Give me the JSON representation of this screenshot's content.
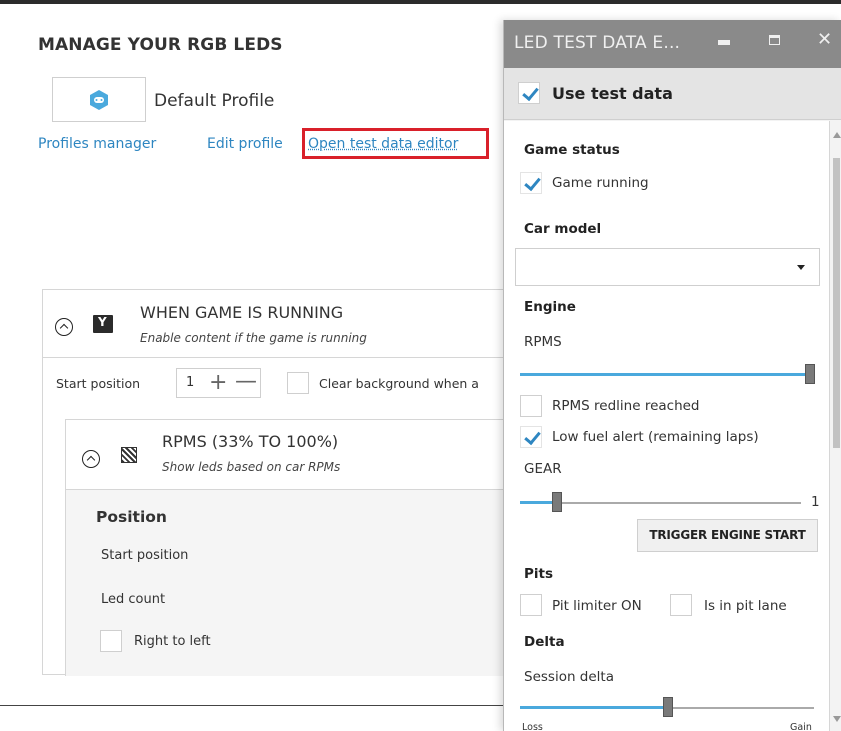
{
  "main": {
    "title": "MANAGE YOUR RGB LEDS",
    "profile_name": "Default Profile",
    "links": {
      "profiles_manager": "Profiles manager",
      "edit_profile": "Edit profile",
      "open_test_data_editor": "Open test data editor"
    },
    "section": {
      "title": "WHEN GAME IS RUNNING",
      "subtitle": "Enable content if the game is running",
      "start_position_label": "Start position",
      "start_position_value": "1",
      "clear_background_label": "Clear background when a"
    },
    "rpms": {
      "title": "RPMS (33% TO 100%)",
      "subtitle": "Show leds based on car RPMs",
      "position_heading": "Position",
      "start_position_label": "Start position",
      "led_count_label": "Led count",
      "right_to_left_label": "Right to left"
    }
  },
  "test_window": {
    "title": "LED TEST DATA E...",
    "use_test_data": {
      "label": "Use test data",
      "checked": true
    },
    "game_status": {
      "heading": "Game status",
      "game_running": {
        "label": "Game running",
        "checked": true
      }
    },
    "car_model": {
      "heading": "Car model",
      "value": ""
    },
    "engine": {
      "heading": "Engine",
      "rpms_label": "RPMS",
      "rpms_level": 1.0,
      "redline": {
        "label": "RPMS redline reached",
        "checked": false
      },
      "low_fuel": {
        "label": "Low fuel alert (remaining laps)",
        "checked": true
      },
      "gear_label": "GEAR",
      "gear_value": "1",
      "trigger_label": "TRIGGER ENGINE START"
    },
    "pits": {
      "heading": "Pits",
      "limiter": {
        "label": "Pit limiter ON",
        "checked": false
      },
      "pit_lane": {
        "label": "Is in pit lane",
        "checked": false
      }
    },
    "delta": {
      "heading": "Delta",
      "session_delta_label": "Session delta",
      "loss_label": "Loss",
      "gain_label": "Gain",
      "level": 0.5
    }
  },
  "colors": {
    "accent": "#2e86c1",
    "highlight": "#d9202a",
    "title_bar": "#8a8a8a"
  }
}
